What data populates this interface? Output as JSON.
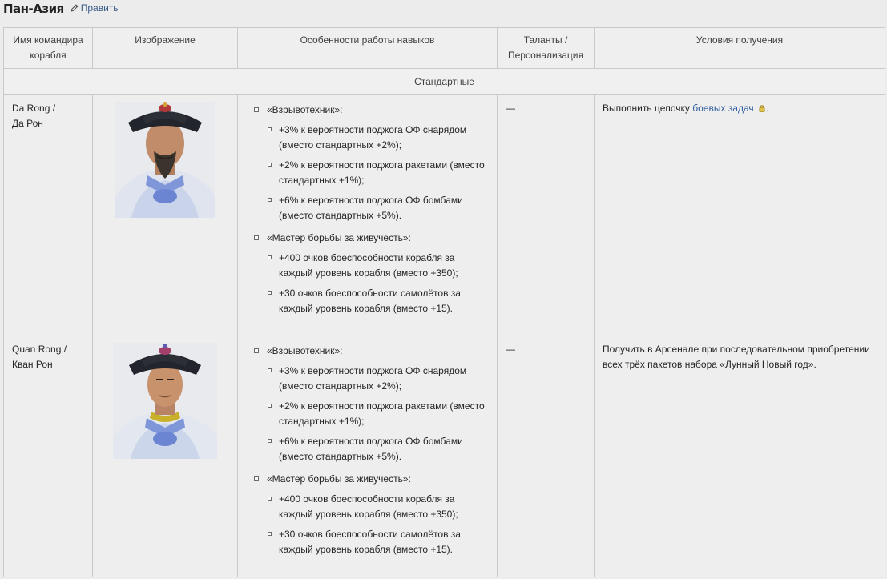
{
  "header": {
    "title": "Пан-Азия",
    "edit_label": "Править"
  },
  "table": {
    "columns": [
      "Имя командира корабля",
      "Изображение",
      "Особенности работы навыков",
      "Таланты / Персонализация",
      "Условия получения"
    ],
    "section_label": "Стандартные",
    "rows": [
      {
        "name_line1": "Da Rong /",
        "name_line2": "Да Рон",
        "skill1_title": "«Взрывотехник»:",
        "skill1_items": [
          "+3% к вероятности поджога ОФ снарядом (вместо стандартных +2%);",
          "+2% к вероятности поджога ракетами (вместо стандартных +1%);",
          "+6% к вероятности поджога ОФ бомбами (вместо стандартных +5%)."
        ],
        "skill2_title": "«Мастер борьбы за живучесть»:",
        "skill2_items": [
          "+400 очков боеспособности корабля за каждый уровень корабля (вместо +350);",
          "+30 очков боеспособности самолётов за каждый уровень корабля (вместо +15)."
        ],
        "talents": "—",
        "cond_text": "Выполнить цепочку ",
        "cond_link": "боевых задач",
        "cond_end": "."
      },
      {
        "name_line1": "Quan Rong /",
        "name_line2": "Кван Рон",
        "skill1_title": "«Взрывотехник»:",
        "skill1_items": [
          "+3% к вероятности поджога ОФ снарядом (вместо стандартных +2%);",
          "+2% к вероятности поджога ракетами (вместо стандартных +1%);",
          "+6% к вероятности поджога ОФ бомбами (вместо стандартных +5%)."
        ],
        "skill2_title": "«Мастер борьбы за живучесть»:",
        "skill2_items": [
          "+400 очков боеспособности корабля за каждый уровень корабля (вместо +350);",
          "+30 очков боеспособности самолётов за каждый уровень корабля (вместо +15)."
        ],
        "talents": "—",
        "cond_text": "Получить в Арсенале при последовательном приобретении всех трёх пакетов набора «Лунный Новый год»."
      }
    ]
  },
  "icons": {
    "edit": "pencil-icon",
    "lock": "lock-icon",
    "portrait1": "commander-portrait",
    "portrait2": "commander-portrait"
  },
  "colors": {
    "link": "#2f5d9e",
    "background": "#ececec",
    "border": "#c9c9c9"
  }
}
